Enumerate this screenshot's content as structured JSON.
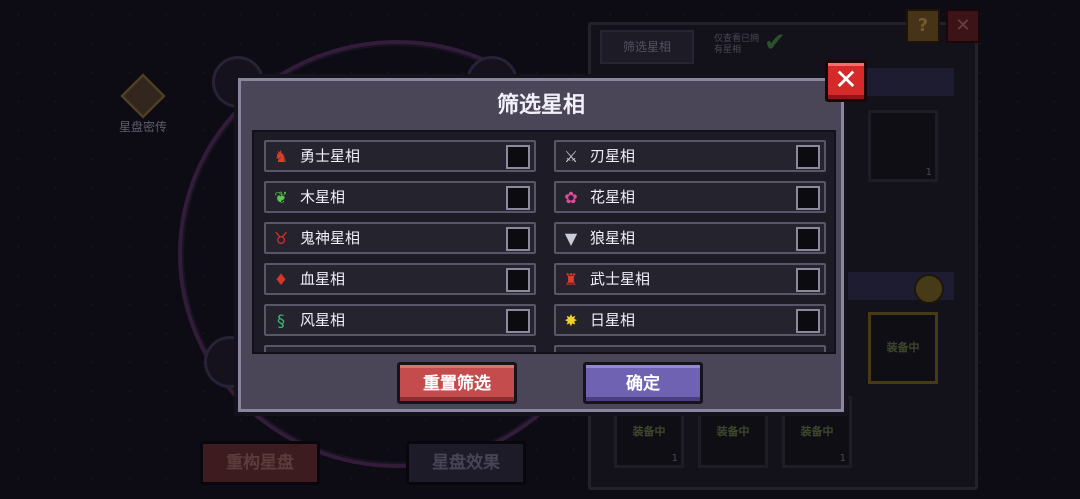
{
  "background": {
    "secret_label": "星盘密传",
    "rebuild_button": "重构星盘",
    "effect_button": "星盘效果",
    "filter_tab": "筛选星相",
    "owned_only_label": "仅查看已拥有星相",
    "equipped_label": "装备中",
    "count": "1",
    "help_glyph": "?",
    "close_glyph": "✕"
  },
  "modal": {
    "title": "筛选星相",
    "close_glyph": "✕",
    "reset_button": "重置筛选",
    "confirm_button": "确定",
    "left_column": [
      {
        "label": "勇士星相",
        "icon": "warrior-icon",
        "checked": false
      },
      {
        "label": "木星相",
        "icon": "leaf-icon",
        "checked": false
      },
      {
        "label": "鬼神星相",
        "icon": "demon-icon",
        "checked": false
      },
      {
        "label": "血星相",
        "icon": "blood-drop-icon",
        "checked": false
      },
      {
        "label": "风星相",
        "icon": "wind-icon",
        "checked": false
      }
    ],
    "right_column": [
      {
        "label": "刃星相",
        "icon": "blade-icon",
        "checked": false
      },
      {
        "label": "花星相",
        "icon": "flower-icon",
        "checked": false
      },
      {
        "label": "狼星相",
        "icon": "wolf-icon",
        "checked": false
      },
      {
        "label": "武士星相",
        "icon": "samurai-icon",
        "checked": false
      },
      {
        "label": "日星相",
        "icon": "sun-icon",
        "checked": false
      }
    ]
  },
  "colors": {
    "reset": "#c44c4c",
    "confirm": "#7062b2",
    "close": "#d42a2a"
  }
}
